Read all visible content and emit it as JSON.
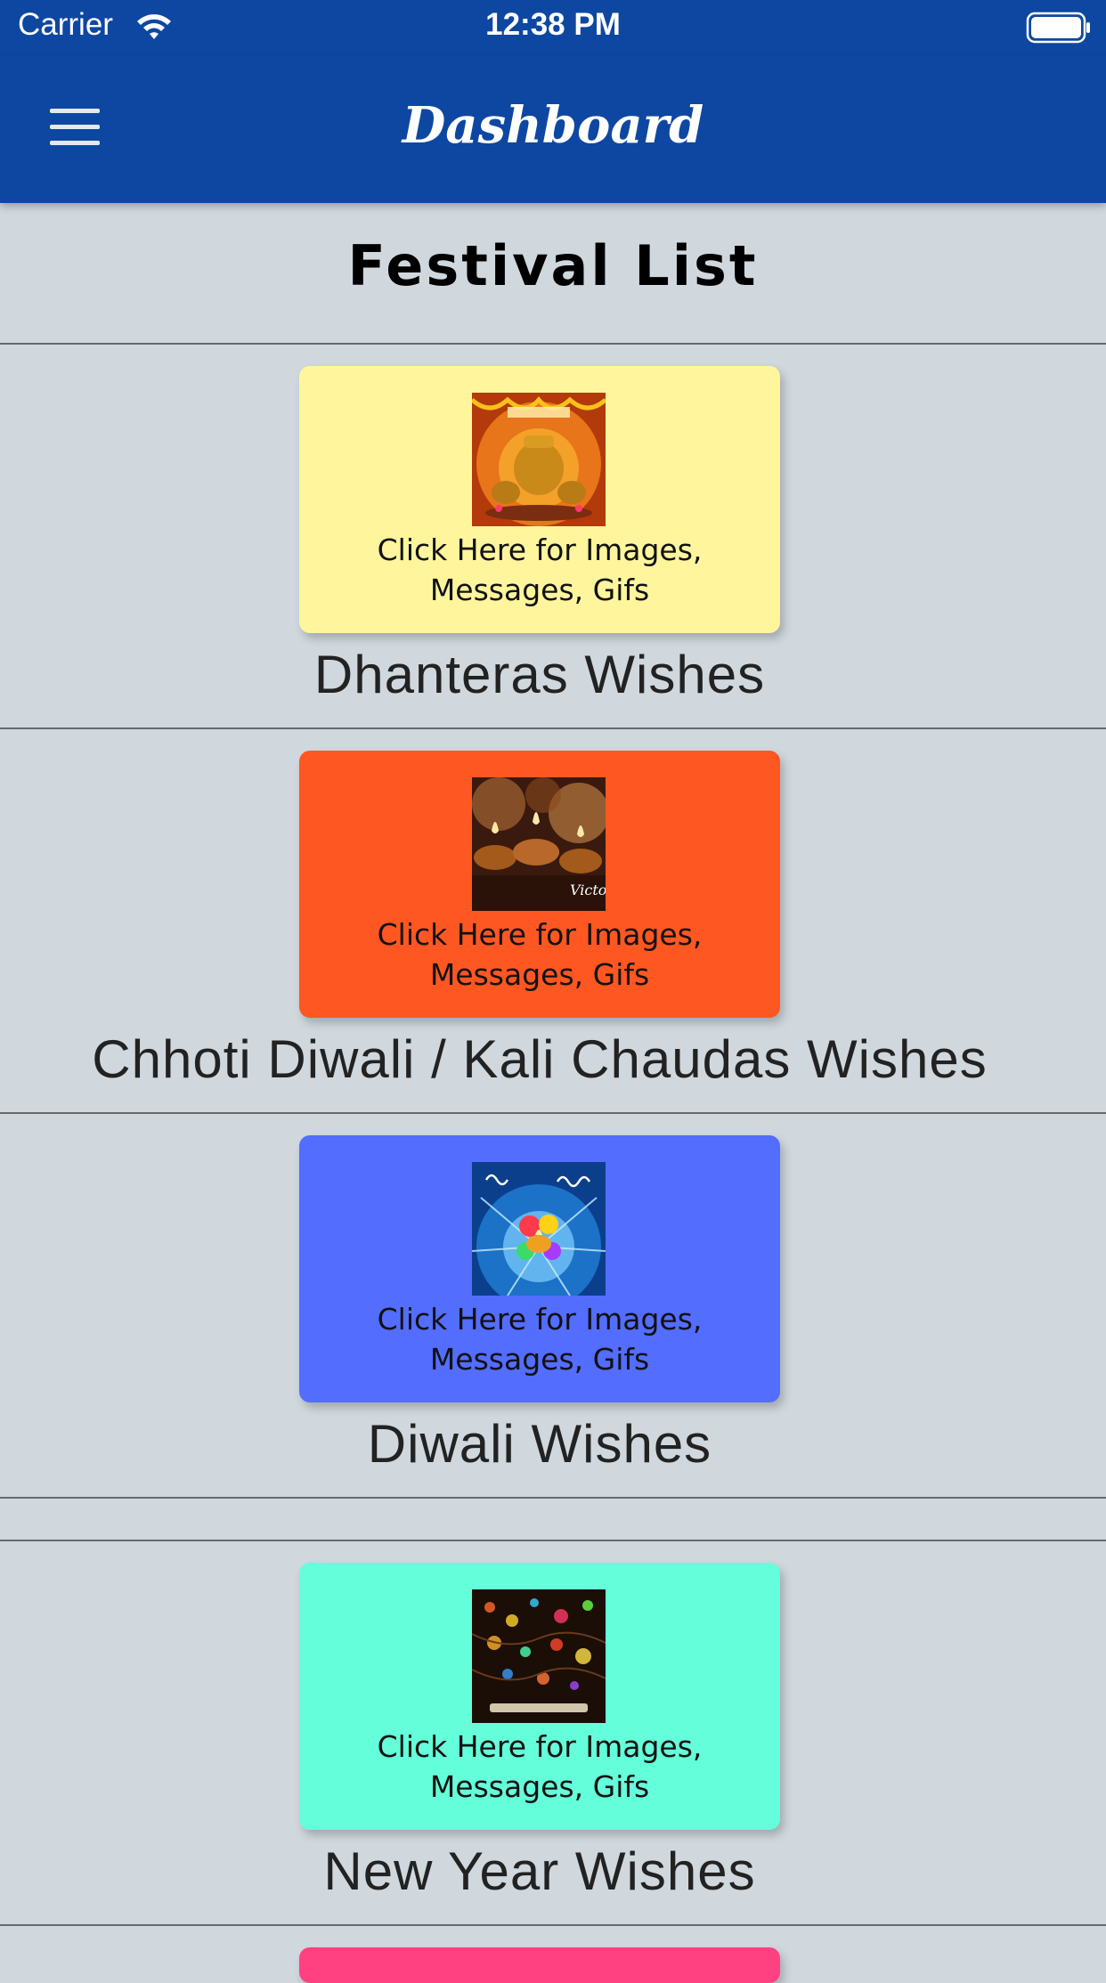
{
  "status_bar": {
    "carrier": "Carrier",
    "time": "12:38 PM",
    "wifi_icon": "wifi-icon",
    "battery_icon": "battery-icon"
  },
  "app_bar": {
    "title": "Dashboard",
    "menu_icon": "hamburger-menu-icon",
    "background_color": "#0d47a1"
  },
  "main": {
    "heading": "Festival List",
    "background_color": "#d0d8de",
    "festivals": [
      {
        "name": "Dhanteras Wishes",
        "card_caption": "Click Here for Images, Messages, Gifs",
        "card_color": "#fff59d"
      },
      {
        "name": "Chhoti Diwali / Kali Chaudas Wishes",
        "card_caption": "Click Here for Images, Messages, Gifs",
        "card_color": "#ff5722"
      },
      {
        "name": "Diwali Wishes",
        "card_caption": "Click Here for Images, Messages, Gifs",
        "card_color": "#536dfe"
      },
      {
        "name": "New Year Wishes",
        "card_caption": "Click Here for Images, Messages, Gifs",
        "card_color": "#64ffda"
      },
      {
        "card_color": "#ff4081"
      }
    ]
  }
}
